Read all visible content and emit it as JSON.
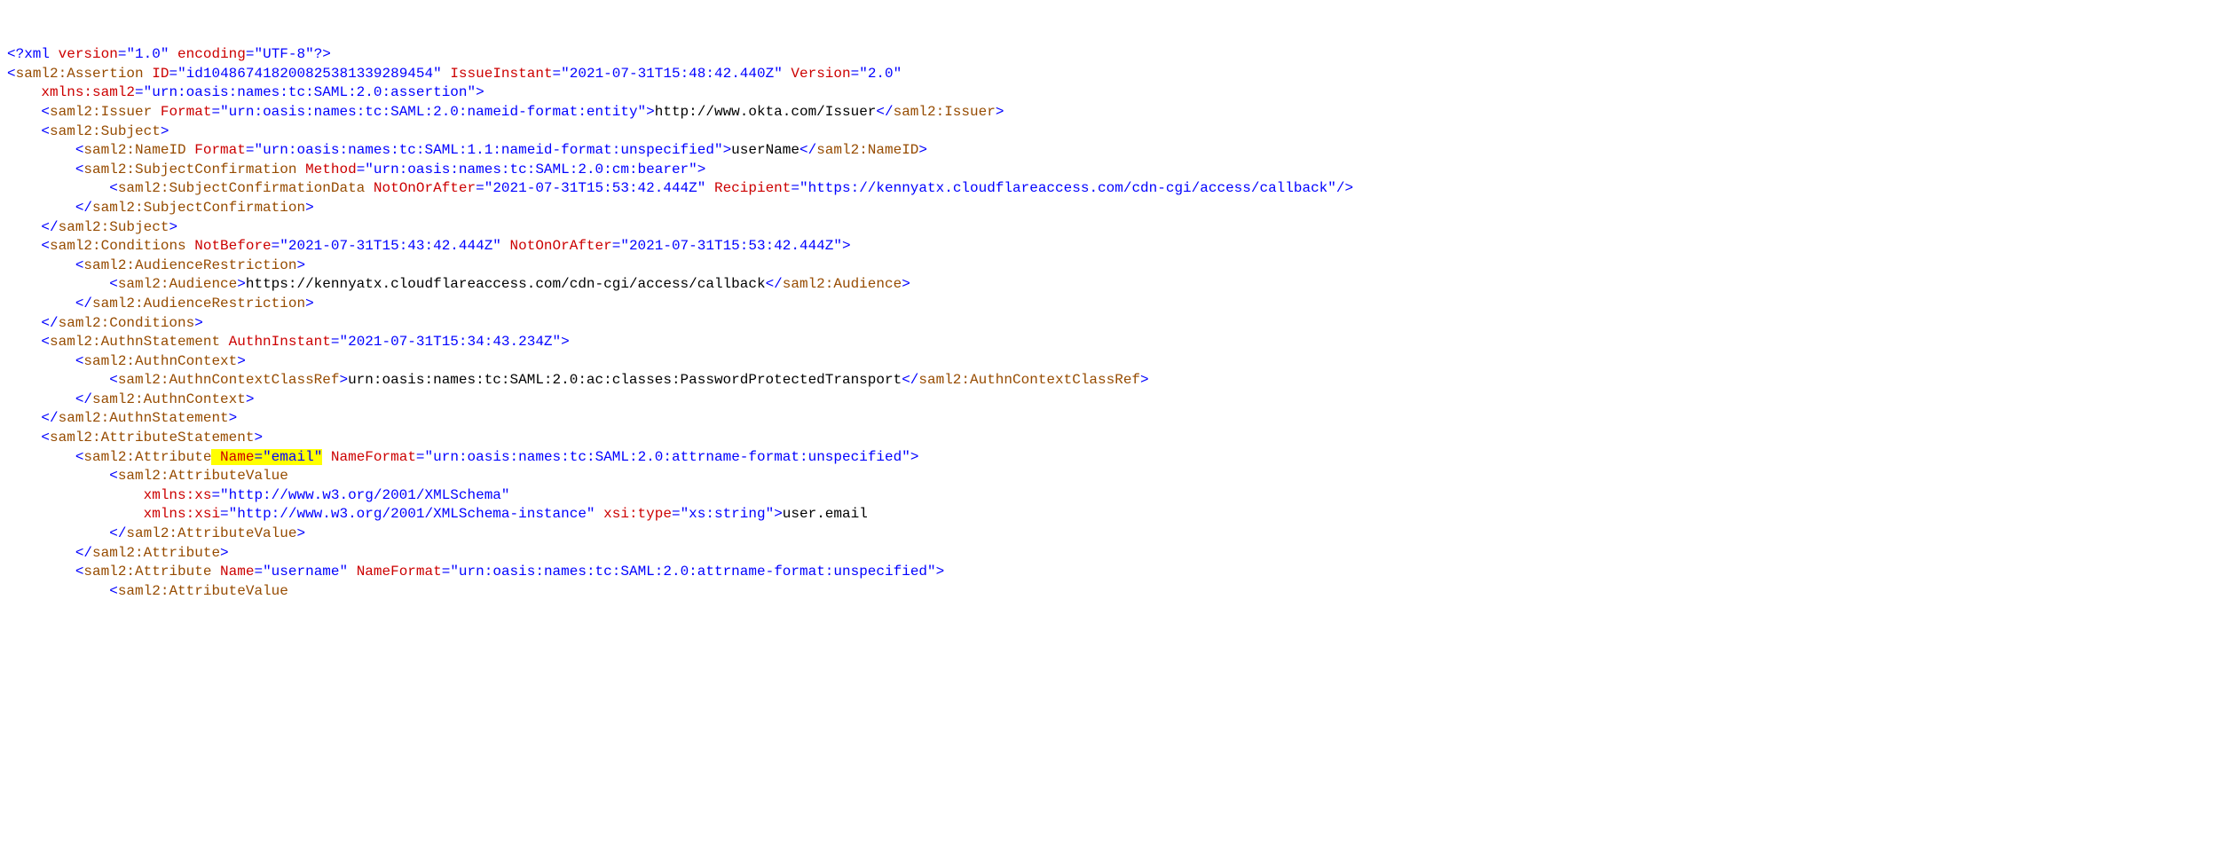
{
  "l1_o": "<?",
  "l1_xml": "xml",
  "l1_a1": " version",
  "l1_e": "=",
  "l1_v1": "\"1.0\"",
  "l1_a2": " encoding",
  "l1_v2": "\"UTF-8\"",
  "l1_c": "?>",
  "l2_o": "<",
  "l2_t": "saml2:Assertion",
  "l2_a1": " ID",
  "l2_v1": "\"id104867418200825381339289454\"",
  "l2_a2": " IssueInstant",
  "l2_v2": "\"2021-07-31T15:48:42.440Z\"",
  "l2_a3": " Version",
  "l2_v3": "\"2.0\"",
  "l3_a": "    xmlns:saml2",
  "l3_v": "\"urn:oasis:names:tc:SAML:2.0:assertion\"",
  "l3_c": ">",
  "l4_o": "    <",
  "l4_t": "saml2:Issuer",
  "l4_a": " Format",
  "l4_v": "\"urn:oasis:names:tc:SAML:2.0:nameid-format:entity\"",
  "l4_gt": ">",
  "l4_tx": "http://www.okta.com/Issuer",
  "l4_co": "</",
  "l4_ct": "saml2:Issuer",
  "l4_cc": ">",
  "l5_o": "    <",
  "l5_t": "saml2:Subject",
  "l5_c": ">",
  "l6_o": "        <",
  "l6_t": "saml2:NameID",
  "l6_a": " Format",
  "l6_v": "\"urn:oasis:names:tc:SAML:1.1:nameid-format:unspecified\"",
  "l6_gt": ">",
  "l6_tx": "userName",
  "l6_co": "</",
  "l6_ct": "saml2:NameID",
  "l6_cc": ">",
  "l7_o": "        <",
  "l7_t": "saml2:SubjectConfirmation",
  "l7_a": " Method",
  "l7_v": "\"urn:oasis:names:tc:SAML:2.0:cm:bearer\"",
  "l7_c": ">",
  "l8_o": "            <",
  "l8_t": "saml2:SubjectConfirmationData",
  "l8_a1": " NotOnOrAfter",
  "l8_v1": "\"2021-07-31T15:53:42.444Z\"",
  "l8_a2": " Recipient",
  "l8_v2": "\"https://kennyatx.cloudflareaccess.com/cdn-cgi/access/callback\"",
  "l8_c": "/>",
  "l9_o": "        </",
  "l9_t": "saml2:SubjectConfirmation",
  "l9_c": ">",
  "l10_o": "    </",
  "l10_t": "saml2:Subject",
  "l10_c": ">",
  "l11_o": "    <",
  "l11_t": "saml2:Conditions",
  "l11_a1": " NotBefore",
  "l11_v1": "\"2021-07-31T15:43:42.444Z\"",
  "l11_a2": " NotOnOrAfter",
  "l11_v2": "\"2021-07-31T15:53:42.444Z\"",
  "l11_c": ">",
  "l12_o": "        <",
  "l12_t": "saml2:AudienceRestriction",
  "l12_c": ">",
  "l13_o": "            <",
  "l13_t": "saml2:Audience",
  "l13_gt": ">",
  "l13_tx": "https://kennyatx.cloudflareaccess.com/cdn-cgi/access/callback",
  "l13_co": "</",
  "l13_ct": "saml2:Audience",
  "l13_cc": ">",
  "l14_o": "        </",
  "l14_t": "saml2:AudienceRestriction",
  "l14_c": ">",
  "l15_o": "    </",
  "l15_t": "saml2:Conditions",
  "l15_c": ">",
  "l16_o": "    <",
  "l16_t": "saml2:AuthnStatement",
  "l16_a": " AuthnInstant",
  "l16_v": "\"2021-07-31T15:34:43.234Z\"",
  "l16_c": ">",
  "l17_o": "        <",
  "l17_t": "saml2:AuthnContext",
  "l17_c": ">",
  "l18_o": "            <",
  "l18_t": "saml2:AuthnContextClassRef",
  "l18_gt": ">",
  "l18_tx": "urn:oasis:names:tc:SAML:2.0:ac:classes:PasswordProtectedTransport",
  "l18_co": "</",
  "l18_ct": "saml2:AuthnContextClassRef",
  "l18_cc": ">",
  "l19_o": "        </",
  "l19_t": "saml2:AuthnContext",
  "l19_c": ">",
  "l20_o": "    </",
  "l20_t": "saml2:AuthnStatement",
  "l20_c": ">",
  "l21_o": "    <",
  "l21_t": "saml2:AttributeStatement",
  "l21_c": ">",
  "l22_o": "        <",
  "l22_t": "saml2:Attribute",
  "l22_hname": " Name",
  "l22_heq": "=",
  "l22_hval": "\"email\"",
  "l22_a2": " NameFormat",
  "l22_v2": "\"urn:oasis:names:tc:SAML:2.0:attrname-format:unspecified\"",
  "l22_c": ">",
  "l23_o": "            <",
  "l23_t": "saml2:AttributeValue",
  "l24_a": "                xmlns:xs",
  "l24_v": "\"http://www.w3.org/2001/XMLSchema\"",
  "l25_a1": "                xmlns:xsi",
  "l25_v1": "\"http://www.w3.org/2001/XMLSchema-instance\"",
  "l25_a2": " xsi:type",
  "l25_v2": "\"xs:string\"",
  "l25_gt": ">",
  "l25_tx": "user.email",
  "l26_o": "            </",
  "l26_t": "saml2:AttributeValue",
  "l26_c": ">",
  "l27_o": "        </",
  "l27_t": "saml2:Attribute",
  "l27_c": ">",
  "l28_o": "        <",
  "l28_t": "saml2:Attribute",
  "l28_a1": " Name",
  "l28_v1": "\"username\"",
  "l28_a2": " NameFormat",
  "l28_v2": "\"urn:oasis:names:tc:SAML:2.0:attrname-format:unspecified\"",
  "l28_c": ">",
  "l29_o": "            <",
  "l29_t": "saml2:AttributeValue"
}
